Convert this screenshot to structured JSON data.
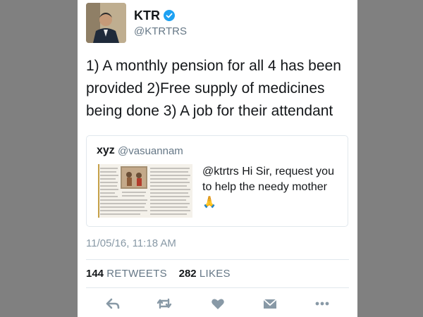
{
  "tweet": {
    "author_name": "KTR",
    "author_handle": "@KTRTRS",
    "text": "1) A monthly pension for all 4 has been provided 2)Free supply of medicines being done 3) A job for their attendant",
    "timestamp": "11/05/16, 11:18 AM",
    "retweet_count": "144",
    "retweet_label": "RETWEETS",
    "like_count": "282",
    "like_label": "LIKES"
  },
  "quoted_tweet": {
    "author_name": "xyz",
    "author_handle": "@vasuannam",
    "text": "@ktrtrs Hi Sir, request you to help the needy mother🙏"
  },
  "icons": {
    "verified": "verified-badge-icon",
    "reply": "reply-icon",
    "retweet": "retweet-icon",
    "like": "heart-icon",
    "message": "envelope-icon",
    "more": "more-dots-icon"
  },
  "colors": {
    "background": "#808080",
    "card": "#ffffff",
    "verified": "#1da1f2",
    "muted_text": "#657786",
    "action_icons": "#8899a6"
  }
}
